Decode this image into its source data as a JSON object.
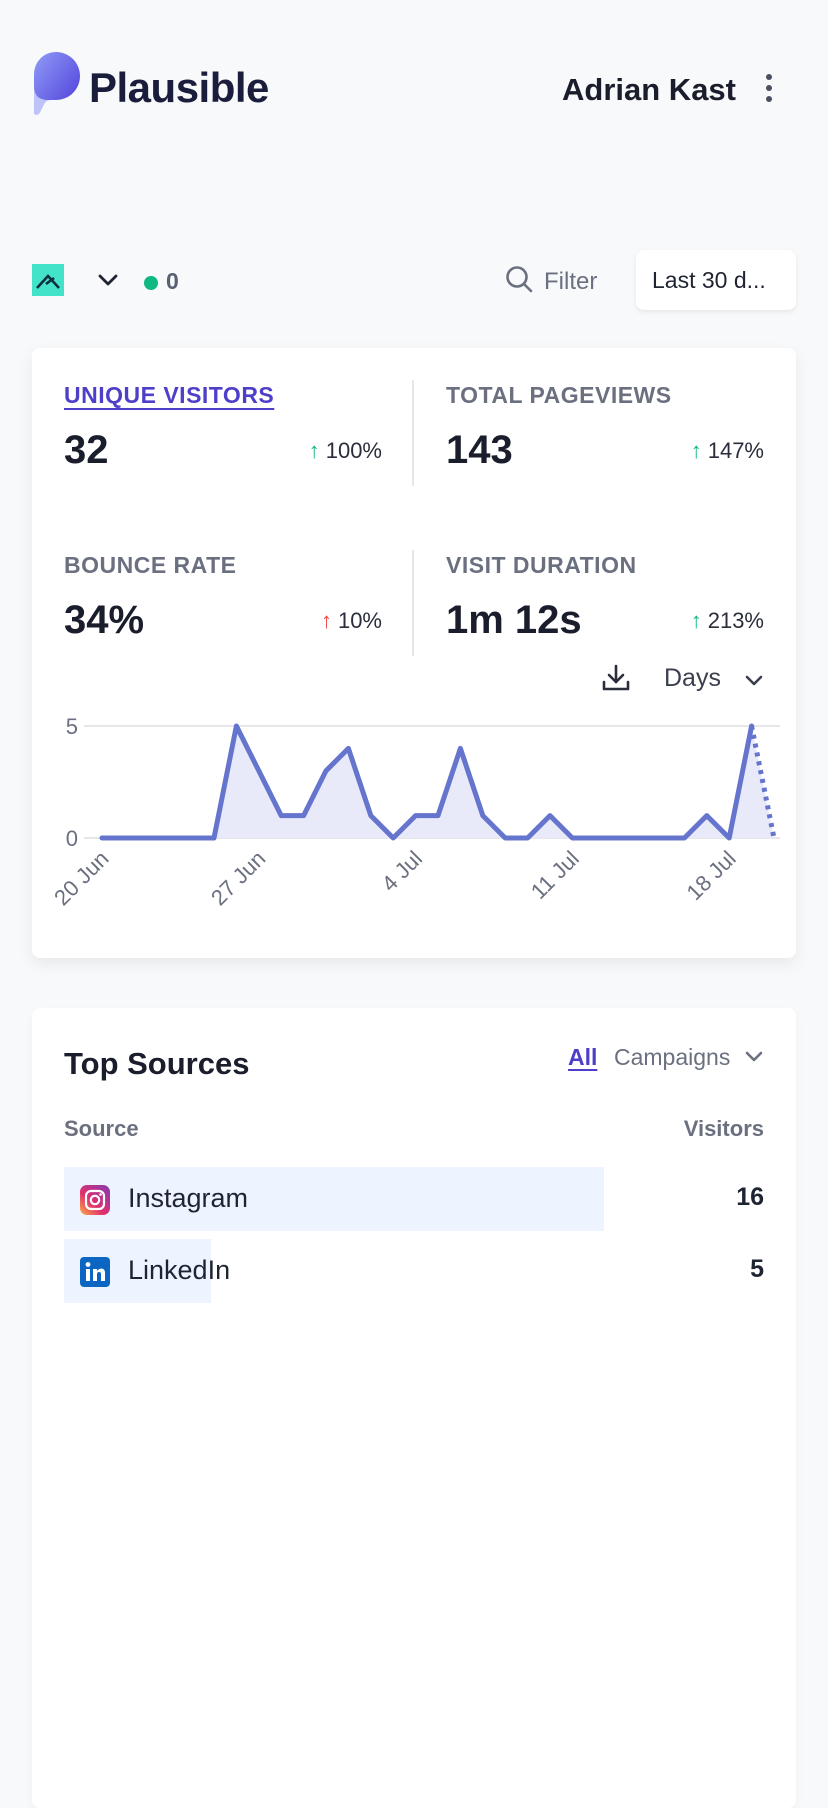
{
  "header": {
    "brand": "Plausible",
    "site_name": "Adrian Kast"
  },
  "toolbar": {
    "live_visitors": "0",
    "filter_label": "Filter",
    "date_range_label": "Last 30 d..."
  },
  "metrics": [
    {
      "label": "UNIQUE VISITORS",
      "value": "32",
      "change": "100%",
      "direction": "up",
      "tone": "good"
    },
    {
      "label": "TOTAL PAGEVIEWS",
      "value": "143",
      "change": "147%",
      "direction": "up",
      "tone": "good"
    },
    {
      "label": "BOUNCE RATE",
      "value": "34%",
      "change": "10%",
      "direction": "up",
      "tone": "bad"
    },
    {
      "label": "VISIT DURATION",
      "value": "1m 12s",
      "change": "213%",
      "direction": "up",
      "tone": "good"
    }
  ],
  "interval": {
    "label": "Days"
  },
  "chart_data": {
    "type": "area",
    "x": [
      "20 Jun",
      "21 Jun",
      "22 Jun",
      "23 Jun",
      "24 Jun",
      "25 Jun",
      "26 Jun",
      "27 Jun",
      "28 Jun",
      "29 Jun",
      "30 Jun",
      "1 Jul",
      "2 Jul",
      "3 Jul",
      "4 Jul",
      "5 Jul",
      "6 Jul",
      "7 Jul",
      "8 Jul",
      "9 Jul",
      "10 Jul",
      "11 Jul",
      "12 Jul",
      "13 Jul",
      "14 Jul",
      "15 Jul",
      "16 Jul",
      "17 Jul",
      "18 Jul",
      "19 Jul"
    ],
    "values": [
      0,
      0,
      0,
      0,
      0,
      0,
      5,
      3,
      1,
      1,
      3,
      4,
      1,
      0,
      1,
      1,
      4,
      1,
      0,
      0,
      1,
      0,
      0,
      0,
      0,
      0,
      0,
      1,
      0,
      5,
      0
    ],
    "tick_labels": [
      "20 Jun",
      "27 Jun",
      "4 Jul",
      "11 Jul",
      "18 Jul"
    ],
    "yticks": [
      "0",
      "5"
    ],
    "ylim": [
      0,
      5
    ],
    "color": "#6574cd",
    "fill": "#e8eafa",
    "last_segment": "dotted",
    "grid": true
  },
  "sources": {
    "title": "Top Sources",
    "tabs": {
      "all": "All",
      "campaigns": "Campaigns"
    },
    "col_source": "Source",
    "col_visitors": "Visitors",
    "rows": [
      {
        "name": "Instagram",
        "visitors": "16",
        "share": 0.772,
        "icon": "instagram-icon"
      },
      {
        "name": "LinkedIn",
        "visitors": "5",
        "share": 0.21,
        "icon": "linkedin-icon"
      }
    ]
  }
}
